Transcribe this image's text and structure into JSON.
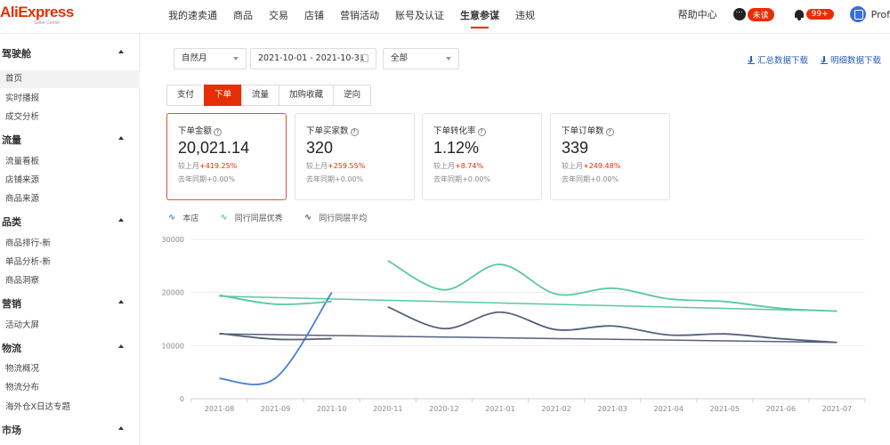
{
  "header": {
    "logo_text": "AliExpress",
    "logo_sub": "Seller Centre",
    "nav": [
      "我的速卖通",
      "商品",
      "交易",
      "店铺",
      "营销活动",
      "账号及认证",
      "生意参谋",
      "违规"
    ],
    "active_nav_index": 6,
    "help": "帮助中心",
    "msg_badge": "未读",
    "notif_badge": "99+",
    "profile": "Prof"
  },
  "sidebar": {
    "groups": [
      {
        "label": "驾驶舱",
        "items": [
          "首页",
          "实时播报",
          "成交分析"
        ]
      },
      {
        "label": "流量",
        "items": [
          "流量看板",
          "店铺来源",
          "商品来源"
        ]
      },
      {
        "label": "品类",
        "items": [
          "商品排行-新",
          "单品分析-新",
          "商品洞察"
        ]
      },
      {
        "label": "营销",
        "items": [
          "活动大屏"
        ]
      },
      {
        "label": "物流",
        "items": [
          "物流概况",
          "物流分布",
          "海外仓X日达专题"
        ]
      },
      {
        "label": "市场",
        "items": []
      }
    ],
    "active_item": "首页"
  },
  "filters": {
    "period": "自然月",
    "date_range": "2021-10-01 - 2021-10-31",
    "scope": "全部",
    "download_summary": "汇总数据下载",
    "download_detail": "明细数据下载"
  },
  "tabs": [
    "支付",
    "下单",
    "流量",
    "加购收藏",
    "逆向"
  ],
  "active_tab_index": 1,
  "cards": [
    {
      "title": "下单金额",
      "value": "20,021.14",
      "mom_label": "较上月",
      "mom": "+419.25%",
      "yoy_label": "去年同期",
      "yoy": "+0.00%"
    },
    {
      "title": "下单买家数",
      "value": "320",
      "mom_label": "较上月",
      "mom": "+259.55%",
      "yoy_label": "去年同期",
      "yoy": "+0.00%"
    },
    {
      "title": "下单转化率",
      "value": "1.12%",
      "mom_label": "较上月",
      "mom": "+8.74%",
      "yoy_label": "去年同期",
      "yoy": "+0.00%"
    },
    {
      "title": "下单订单数",
      "value": "339",
      "mom_label": "较上月",
      "mom": "+249.48%",
      "yoy_label": "去年同期",
      "yoy": "+0.00%"
    }
  ],
  "active_card_index": 0,
  "legend": [
    {
      "name": "本店",
      "color": "#4a7fd4"
    },
    {
      "name": "同行同层优秀",
      "color": "#5ac8a0"
    },
    {
      "name": "同行同层平均",
      "color": "#55607a"
    }
  ],
  "chart_data": {
    "type": "line",
    "x": [
      "2021-08",
      "2021-09",
      "2021-10",
      "2020-11",
      "2020-12",
      "2021-01",
      "2021-02",
      "2021-03",
      "2021-04",
      "2021-05",
      "2021-06",
      "2021-07"
    ],
    "ylim": [
      0,
      30000
    ],
    "yticks": [
      0,
      10000,
      20000,
      30000
    ],
    "series": [
      {
        "name": "本店",
        "color": "#4a7fd4",
        "segments": [
          {
            "x": [
              0,
              1,
              2
            ],
            "values": [
              3800,
              3900,
              20000
            ]
          }
        ]
      },
      {
        "name": "同行同层优秀",
        "color": "#5ac8a0",
        "segments": [
          {
            "x": [
              0,
              1,
              2
            ],
            "values": [
              19500,
              17800,
              18300
            ]
          },
          {
            "x": [
              3,
              4,
              5,
              6,
              7,
              8,
              9,
              10,
              11
            ],
            "values": [
              26000,
              20500,
              25300,
              19700,
              20800,
              18800,
              18300,
              17000,
              16500
            ]
          }
        ]
      },
      {
        "name": "同行同层平均",
        "color": "#55607a",
        "segments": [
          {
            "x": [
              0,
              1,
              2
            ],
            "values": [
              12300,
              11200,
              11300
            ]
          },
          {
            "x": [
              3,
              4,
              5,
              6,
              7,
              8,
              9,
              10,
              11
            ],
            "values": [
              17300,
              13200,
              16300,
              13000,
              13700,
              12000,
              12200,
              11300,
              10600
            ]
          }
        ]
      }
    ],
    "trend_lines": [
      {
        "color": "#5ac8a0",
        "from": [
          0,
          19300
        ],
        "to": [
          11,
          16500
        ]
      },
      {
        "color": "#55607a",
        "from": [
          0,
          12200
        ],
        "to": [
          11,
          10600
        ]
      }
    ]
  }
}
